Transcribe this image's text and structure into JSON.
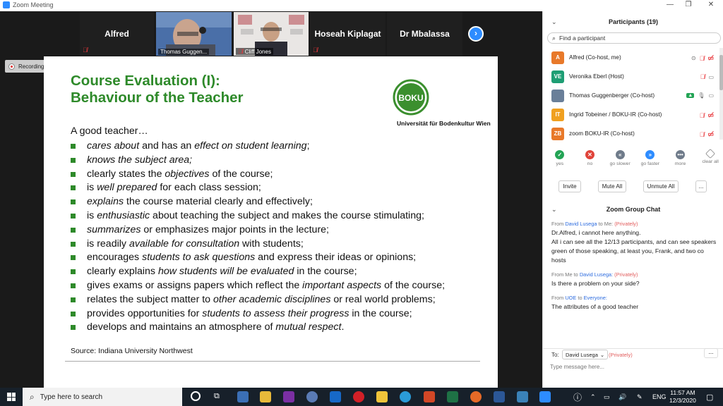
{
  "window": {
    "title": "Zoom Meeting"
  },
  "video_strip": {
    "tiles": [
      {
        "name": "Alfred",
        "type": "name"
      },
      {
        "name": "Thomas Guggen...",
        "type": "video"
      },
      {
        "name": "Cliff Jones",
        "type": "video"
      },
      {
        "name": "Hoseah Kiplagat",
        "type": "name"
      },
      {
        "name": "Dr Mbalassa",
        "type": "name"
      }
    ],
    "next_icon": "chevron-right-icon"
  },
  "recording": {
    "label": "Recording..."
  },
  "slide": {
    "title_line1": "Course Evaluation (I):",
    "title_line2": "Behaviour of the Teacher",
    "logo_text": "BOKU",
    "logo_sub": "Universität für Bodenkultur Wien",
    "intro": "A good teacher…",
    "bullets": [
      [
        {
          "t": "cares about",
          "i": true
        },
        {
          "t": " and has an ",
          "i": false
        },
        {
          "t": "effect on student learning",
          "i": true
        },
        {
          "t": ";",
          "i": false
        }
      ],
      [
        {
          "t": "knows the subject area;",
          "i": true
        }
      ],
      [
        {
          "t": "clearly states the ",
          "i": false
        },
        {
          "t": "objectives",
          "i": true
        },
        {
          "t": " of the course;",
          "i": false
        }
      ],
      [
        {
          "t": "is ",
          "i": false
        },
        {
          "t": "well prepared",
          "i": true
        },
        {
          "t": " for each class session;",
          "i": false
        }
      ],
      [
        {
          "t": "explains",
          "i": true
        },
        {
          "t": " the course material clearly and effectively;",
          "i": false
        }
      ],
      [
        {
          "t": "is ",
          "i": false
        },
        {
          "t": "enthusiastic",
          "i": true
        },
        {
          "t": " about teaching the subject and makes the course stimulating;",
          "i": false
        }
      ],
      [
        {
          "t": "summarizes",
          "i": true
        },
        {
          "t": " or emphasizes major points in the lecture;",
          "i": false
        }
      ],
      [
        {
          "t": "is readily ",
          "i": false
        },
        {
          "t": "available for consultation",
          "i": true
        },
        {
          "t": " with students;",
          "i": false
        }
      ],
      [
        {
          "t": "encourages ",
          "i": false
        },
        {
          "t": "students to ask questions",
          "i": true
        },
        {
          "t": " and express their ideas or opinions;",
          "i": false
        }
      ],
      [
        {
          "t": "clearly explains ",
          "i": false
        },
        {
          "t": "how students will be evaluated",
          "i": true
        },
        {
          "t": " in the course;",
          "i": false
        }
      ],
      [
        {
          "t": "gives exams or assigns papers which reflect the ",
          "i": false
        },
        {
          "t": "important aspects",
          "i": true
        },
        {
          "t": " of the course;",
          "i": false
        }
      ],
      [
        {
          "t": "relates the subject matter to ",
          "i": false
        },
        {
          "t": "other academic disciplines",
          "i": true
        },
        {
          "t": " or real world problems;",
          "i": false
        }
      ],
      [
        {
          "t": "provides opportunities for ",
          "i": false
        },
        {
          "t": "students to assess their progress",
          "i": true
        },
        {
          "t": " in the course;",
          "i": false
        }
      ],
      [
        {
          "t": "develops and maintains an atmosphere of ",
          "i": false
        },
        {
          "t": "mutual respect",
          "i": true
        },
        {
          "t": ".",
          "i": false
        }
      ]
    ],
    "source": "Source: Indiana University Northwest"
  },
  "participants": {
    "header": "Participants (19)",
    "search_placeholder": "Find a participant",
    "list": [
      {
        "initials": "A",
        "name": "Alfred (Co-host, me)",
        "color": "#e8792a"
      },
      {
        "initials": "VE",
        "name": "Veronika Eberl (Host)",
        "color": "#1e9e74"
      },
      {
        "initials": "",
        "name": "Thomas Guggenberger (Co-host)",
        "color": "#6a7f99"
      },
      {
        "initials": "IT",
        "name": "Ingrid Tobeiner / BOKU-IR (Co-host)",
        "color": "#f0a020"
      },
      {
        "initials": "ZB",
        "name": "zoom BOKU-IR (Co-host)",
        "color": "#e8792a"
      }
    ],
    "reactions": [
      {
        "label": "yes",
        "color": "#23a455",
        "glyph": "✓"
      },
      {
        "label": "no",
        "color": "#e0443a",
        "glyph": "✕"
      },
      {
        "label": "go slower",
        "color": "#6f7b8a",
        "glyph": "«"
      },
      {
        "label": "go faster",
        "color": "#2d8cff",
        "glyph": "»"
      },
      {
        "label": "more",
        "color": "#6f7b8a",
        "glyph": "•••"
      },
      {
        "label": "clear all",
        "color": "#ffffff",
        "glyph": ""
      }
    ],
    "buttons": {
      "invite": "Invite",
      "mute_all": "Mute All",
      "unmute_all": "Unmute All",
      "more": "..."
    }
  },
  "chat": {
    "header": "Zoom Group Chat",
    "messages": [
      {
        "from": "From",
        "sender": "David Lusega",
        "to": "to Me:",
        "privacy": "(Privately)",
        "text": "Dr.Alfred, i cannot here anything.\nAll i can see all the 12/13 participants, and can see speakers green of those speaking, at least you, Frank, and two co hosts"
      },
      {
        "from": "From Me to",
        "sender": "David Lusega:",
        "to": "",
        "privacy": "(Privately)",
        "text": "Is there a problem on your side?"
      },
      {
        "from": "From",
        "sender": "UOE",
        "to": "to",
        "sender2": "Everyone:",
        "privacy": "",
        "text": "The attributes of a good teacher"
      }
    ],
    "to_label": "To:",
    "recipient": "David Lusega",
    "recipient_privacy": "(Privately)",
    "input_placeholder": "Type message here...",
    "more_btn": "..."
  },
  "taskbar": {
    "search_placeholder": "Type here to search",
    "time": "11:57 AM",
    "date": "12/3/2020",
    "lang": "ENG"
  }
}
